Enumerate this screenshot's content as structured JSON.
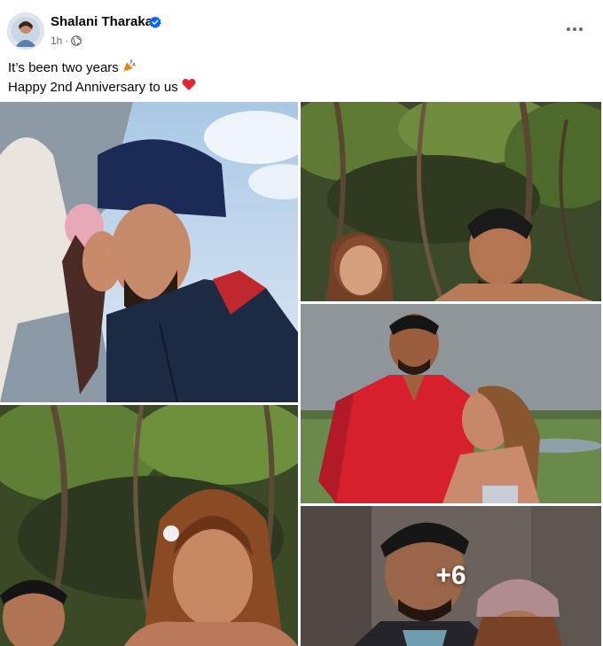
{
  "post": {
    "author": {
      "name": "Shalani Tharaka",
      "verified": true,
      "avatar_icon": "profile-avatar"
    },
    "meta": {
      "time": "1h",
      "separator": "·",
      "audience_icon": "globe-icon"
    },
    "menu_icon": "more-horizontal-icon",
    "caption": {
      "line1": "It’s been two years",
      "line1_emoji": "🎉",
      "line2": "Happy 2nd Anniversary to us",
      "line2_emoji": "❤️"
    },
    "gallery": {
      "more_count": "+6"
    }
  },
  "colors": {
    "verified_blue": "#0866ff",
    "secondary_text": "#65676b",
    "primary_text": "#050505",
    "heart_red": "#e0262e"
  }
}
